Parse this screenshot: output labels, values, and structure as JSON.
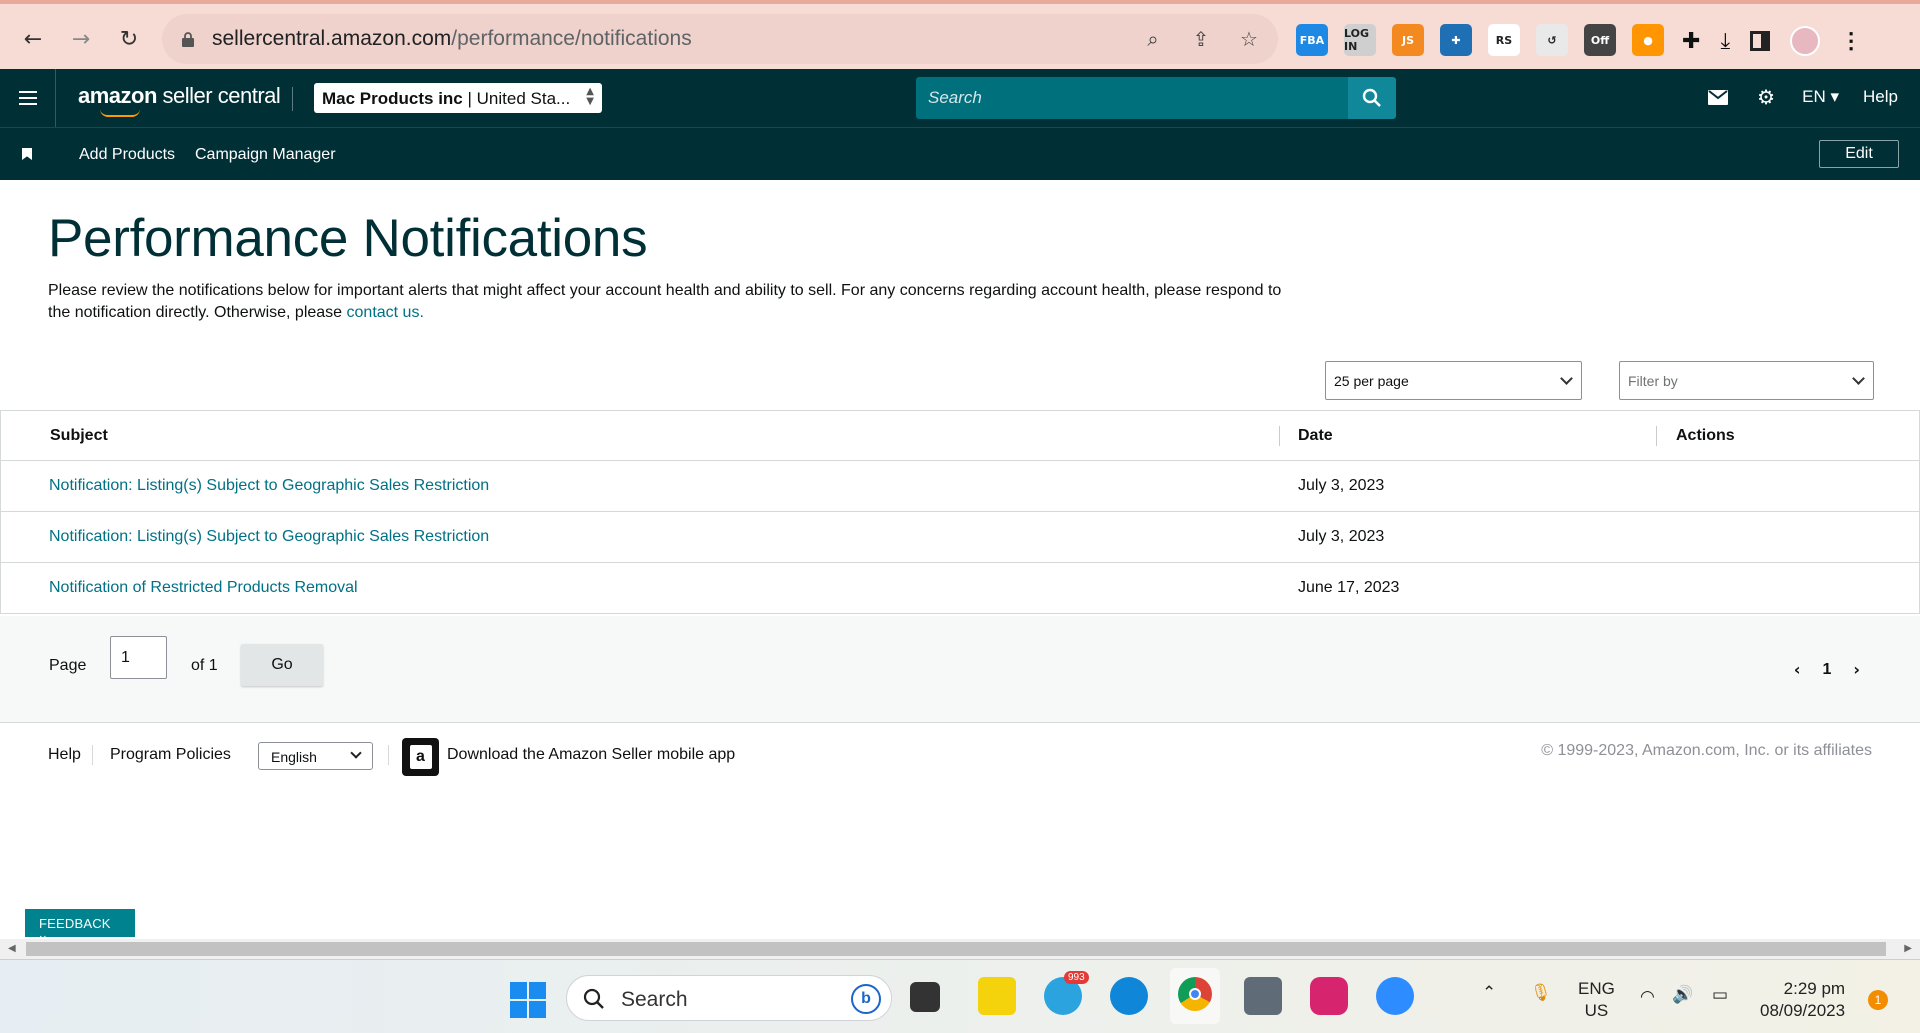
{
  "browser": {
    "url_host": "sellercentral.amazon.com",
    "url_path": "/performance/notifications",
    "extensions": [
      {
        "name": "fba-ext",
        "label": "FBA",
        "color": "#1e88e5"
      },
      {
        "name": "login-ext",
        "label": "LOG IN",
        "color": "#cfcfcf"
      },
      {
        "name": "js-ext",
        "label": "JS",
        "color": "#f4891f"
      },
      {
        "name": "helper-ext",
        "label": "✚",
        "color": "#1f6fb5"
      },
      {
        "name": "rs-ext",
        "label": "RS",
        "color": "#ffffff"
      },
      {
        "name": "history-ext",
        "label": "↺",
        "color": "#e9e9e9"
      },
      {
        "name": "off-ext",
        "label": "Off",
        "color": "#444"
      },
      {
        "name": "firefox-like-ext",
        "label": "●",
        "color": "#ff9500"
      }
    ]
  },
  "header": {
    "logo_main": "amazon",
    "logo_sub": "seller central",
    "account_name": "Mac Products inc",
    "account_market": "| United Sta...",
    "search_placeholder": "Search",
    "language": "EN",
    "help": "Help"
  },
  "subnav": {
    "items": [
      "Add Products",
      "Campaign Manager"
    ],
    "edit": "Edit"
  },
  "main": {
    "title": "Performance Notifications",
    "intro_text": "Please review the notifications below for important alerts that might affect your account health and ability to sell. For any concerns regarding account health, please respond to the notification directly. Otherwise, please ",
    "intro_link": "contact us.",
    "per_page": "25 per page",
    "filter_placeholder": "Filter by",
    "columns": {
      "subject": "Subject",
      "date": "Date",
      "actions": "Actions"
    },
    "rows": [
      {
        "subject": "Notification: Listing(s) Subject to Geographic Sales Restriction",
        "date": "July 3, 2023"
      },
      {
        "subject": "Notification: Listing(s) Subject to Geographic Sales Restriction",
        "date": "July 3, 2023"
      },
      {
        "subject": "Notification of Restricted Products Removal",
        "date": "June 17, 2023"
      }
    ],
    "pager": {
      "page_label": "Page",
      "page_value": "1",
      "of_label": "of 1",
      "go": "Go",
      "current": "1"
    }
  },
  "footer": {
    "help": "Help",
    "policies": "Program Policies",
    "language": "English",
    "app_text": "Download the Amazon Seller mobile app",
    "copyright": "© 1999-2023, Amazon.com, Inc. or its affiliates"
  },
  "feedback": "FEEDBACK ×",
  "taskbar": {
    "search": "Search",
    "telegram_badge": "993",
    "lang_top": "ENG",
    "lang_bottom": "US",
    "time": "2:29 pm",
    "date": "08/09/2023",
    "notif_count": "1"
  }
}
